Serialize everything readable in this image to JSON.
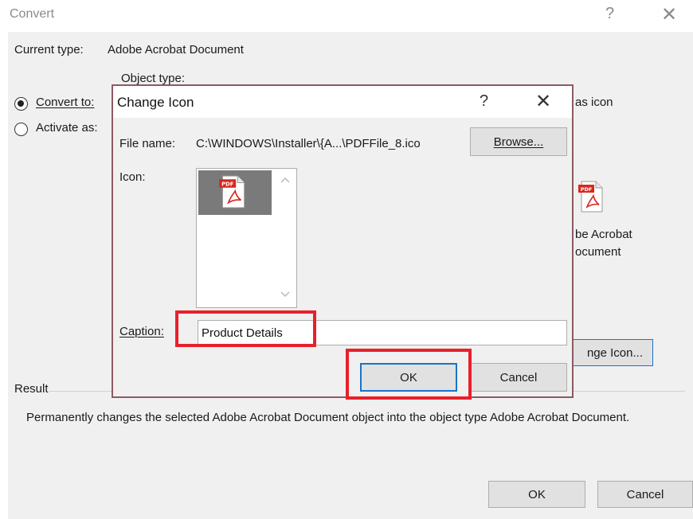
{
  "convert": {
    "title": "Convert",
    "help_glyph": "?",
    "close_glyph": "✕",
    "current_type_label": "Current type:",
    "current_type_value": "Adobe Acrobat Document",
    "object_type_label": "Object type:",
    "convert_to_label": "Convert to:",
    "activate_as_label": "Activate as:",
    "convert_to_selected": true,
    "display_as_icon_partial": "as icon",
    "icon_caption_line1": "be Acrobat",
    "icon_caption_line2": "ocument",
    "change_icon_button_partial": "nge Icon...",
    "result_label": "Result",
    "result_text": "Permanently changes the selected Adobe Acrobat Document object into the object type Adobe Acrobat Document.",
    "ok_label": "OK",
    "cancel_label": "Cancel"
  },
  "change_icon": {
    "title": "Change Icon",
    "help_glyph": "?",
    "close_glyph": "✕",
    "file_name_label": "File name:",
    "file_name_value": "C:\\WINDOWS\\Installer\\{A...\\PDFFile_8.ico",
    "browse_label": "Browse...",
    "icon_label": "Icon:",
    "pdf_badge": "PDF",
    "caption_label": "Caption:",
    "caption_value": "Product Details",
    "ok_label": "OK",
    "cancel_label": "Cancel"
  },
  "colors": {
    "highlight": "#e8202a",
    "focus_border": "#1a73c8",
    "pdf_red": "#d9261c"
  }
}
